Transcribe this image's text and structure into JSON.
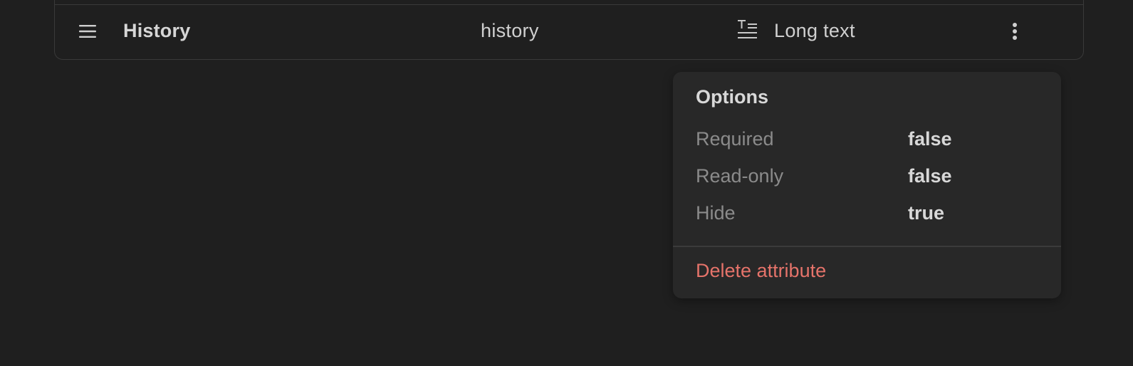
{
  "attribute": {
    "name": "History",
    "key": "history",
    "type_label": "Long text",
    "type_icon": "long-text-icon",
    "drag_icon": "hamburger-icon",
    "menu_icon": "kebab-icon"
  },
  "options_menu": {
    "title": "Options",
    "rows": [
      {
        "label": "Required",
        "value": "false"
      },
      {
        "label": "Read-only",
        "value": "false"
      },
      {
        "label": "Hide",
        "value": "true"
      }
    ],
    "delete_label": "Delete attribute"
  },
  "colors": {
    "background": "#1f1f1f",
    "menu_background": "#282828",
    "danger": "#e5736a",
    "muted_text": "#8b8b8b"
  }
}
